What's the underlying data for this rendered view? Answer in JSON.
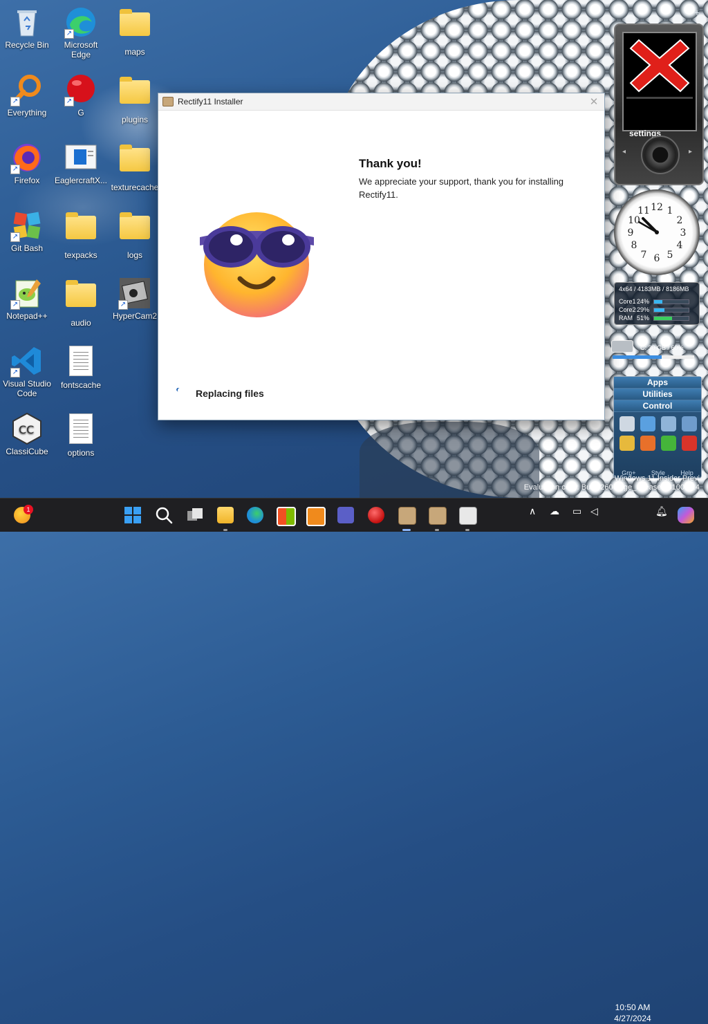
{
  "desktop": {
    "icons": [
      {
        "label": "Recycle Bin"
      },
      {
        "label": "Microsoft Edge"
      },
      {
        "label": "maps"
      },
      {
        "label": "Everything"
      },
      {
        "label": "G"
      },
      {
        "label": "plugins"
      },
      {
        "label": "Firefox"
      },
      {
        "label": "EaglercraftX..."
      },
      {
        "label": "texturecache"
      },
      {
        "label": "Git Bash"
      },
      {
        "label": "texpacks"
      },
      {
        "label": "logs"
      },
      {
        "label": "Notepad++"
      },
      {
        "label": "audio"
      },
      {
        "label": "HyperCam2"
      },
      {
        "label": "Visual Studio Code"
      },
      {
        "label": "fontscache"
      },
      {
        "label": "ClassiCube"
      },
      {
        "label": "options"
      }
    ]
  },
  "installer": {
    "title": "Rectify11 Installer",
    "close_glyph": "✕",
    "heading": "Thank you!",
    "message": "We appreciate your support, thank you for installing Rectify11.",
    "status": "Replacing files",
    "emoji_icon": "smiling-face-with-sunglasses-icon"
  },
  "gadgets": {
    "media_settings_label": "settings",
    "media_status_icon": "red-x-icon",
    "cpu_header": "4x64 / 4183MB / 8186MB",
    "cpu_rows": [
      {
        "name": "Core1",
        "pct": "24%",
        "value": 24
      },
      {
        "name": "Core2",
        "pct": "29%",
        "value": 29
      },
      {
        "name": "RAM",
        "pct": "51%",
        "value": 51
      }
    ],
    "drive_label": "C: 30 GB / 60%",
    "drive_value": 60,
    "launcher_tabs": [
      "Apps",
      "Utilities",
      "Control"
    ],
    "launcher_footer": [
      "Grp+",
      "Style",
      "Help"
    ]
  },
  "watermark": {
    "line1": "Windows 11 Insider Previ",
    "line2": "Evaluation copy. Build 26000.ge_release.231008-14"
  },
  "taskbar": {
    "weather_badge": "1",
    "time": "10:50 AM",
    "date": "4/27/2024",
    "tray_chevron": "∧"
  },
  "colors": {
    "accent": "#1a5fb4",
    "taskbar_bg": "#1f1f22"
  }
}
